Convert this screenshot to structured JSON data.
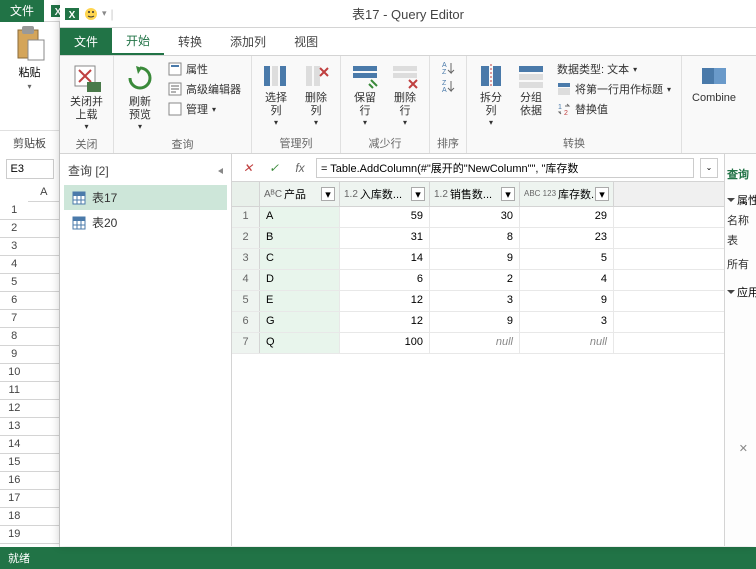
{
  "excel": {
    "file_tab": "文件",
    "paste_label": "粘贴",
    "clipboard_group": "剪贴板",
    "name_box": "E3",
    "col_a": "A",
    "status": "就绪"
  },
  "qe": {
    "title": "表17 - Query Editor",
    "tabs": {
      "file": "文件",
      "home": "开始",
      "transform": "转换",
      "addcol": "添加列",
      "view": "视图"
    },
    "ribbon": {
      "close_apply": "关闭并\n上载",
      "close_group": "关闭",
      "refresh": "刷新\n预览",
      "properties": "属性",
      "adv_editor": "高级编辑器",
      "manage": "管理",
      "query_group": "查询",
      "choose_cols": "选择\n列",
      "remove_cols": "删除\n列",
      "manage_cols_group": "管理列",
      "keep_rows": "保留\n行",
      "remove_rows": "删除\n行",
      "reduce_rows_group": "减少行",
      "sort_group": "排序",
      "split_col": "拆分\n列",
      "group_by": "分组\n依据",
      "datatype": "数据类型: 文本",
      "first_row_header": "将第一行用作标题",
      "replace_values": "替换值",
      "transform_group": "转换",
      "combine": "Combine"
    },
    "nav": {
      "header": "查询 [2]",
      "items": [
        "表17",
        "表20"
      ]
    },
    "formula": "= Table.AddColumn(#\"展开的\"NewColumn\"\", \"库存数",
    "columns": [
      {
        "type": "AᴮC",
        "name": "产品"
      },
      {
        "type": "1.2",
        "name": "入库数..."
      },
      {
        "type": "1.2",
        "name": "销售数..."
      },
      {
        "type": "ABC\n123",
        "name": "库存数..."
      }
    ],
    "rows": [
      {
        "n": 1,
        "p": "A",
        "v1": "59",
        "v2": "30",
        "v3": "29"
      },
      {
        "n": 2,
        "p": "B",
        "v1": "31",
        "v2": "8",
        "v3": "23"
      },
      {
        "n": 3,
        "p": "C",
        "v1": "14",
        "v2": "9",
        "v3": "5"
      },
      {
        "n": 4,
        "p": "D",
        "v1": "6",
        "v2": "2",
        "v3": "4"
      },
      {
        "n": 5,
        "p": "E",
        "v1": "12",
        "v2": "3",
        "v3": "9"
      },
      {
        "n": 6,
        "p": "G",
        "v1": "12",
        "v2": "9",
        "v3": "3"
      },
      {
        "n": 7,
        "p": "Q",
        "v1": "100",
        "v2": "null",
        "v3": "null"
      }
    ],
    "side": {
      "title": "查询",
      "props": "属性",
      "name_label": "名称",
      "name_value": "表",
      "all": "所有",
      "applied": "应用"
    }
  }
}
